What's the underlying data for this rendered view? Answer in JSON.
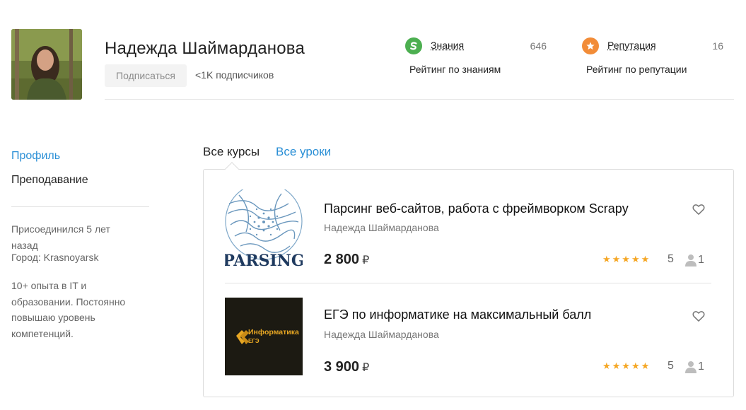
{
  "profile": {
    "name": "Надежда Шаймарданова",
    "subscribe_label": "Подписаться",
    "subscribers_label": "<1K подписчиков"
  },
  "stats": {
    "knowledge": {
      "label": "Знания",
      "value": "646",
      "caption": "Рейтинг по знаниям",
      "color": "#4caf50",
      "icon": "knowledge-icon"
    },
    "reputation": {
      "label": "Репутация",
      "value": "16",
      "caption": "Рейтинг по репутации",
      "color": "#f28c38",
      "icon": "star-icon"
    }
  },
  "sidebar": {
    "items": [
      {
        "label": "Профиль",
        "active": true
      },
      {
        "label": "Преподавание",
        "active": false
      }
    ],
    "joined": "Присоединился 5 лет назад",
    "city": "Город: Krasnoyarsk",
    "bio": "10+ опыта в IT и образовании. Постоянно повышаю уровень компетенций."
  },
  "tabs": [
    {
      "label": "Все курсы",
      "active": true
    },
    {
      "label": "Все уроки",
      "active": false
    }
  ],
  "courses": [
    {
      "title": "Парсинг веб-сайтов, работа с фреймворком Scrapy",
      "author": "Надежда Шаймарданова",
      "price": "2 800",
      "currency": "₽",
      "stars": "★★★★★",
      "rating": "5",
      "learners": "1",
      "thumb_text": "PARSING"
    },
    {
      "title": "ЕГЭ по информатике на максимальный балл",
      "author": "Надежда Шаймарданова",
      "price": "3 900",
      "currency": "₽",
      "stars": "★★★★★",
      "rating": "5",
      "learners": "1",
      "thumb_text_1": "Информатика",
      "thumb_text_2": "ЕГЭ"
    }
  ],
  "colors": {
    "accent_link": "#2a8fd6",
    "star": "#f5a623"
  }
}
